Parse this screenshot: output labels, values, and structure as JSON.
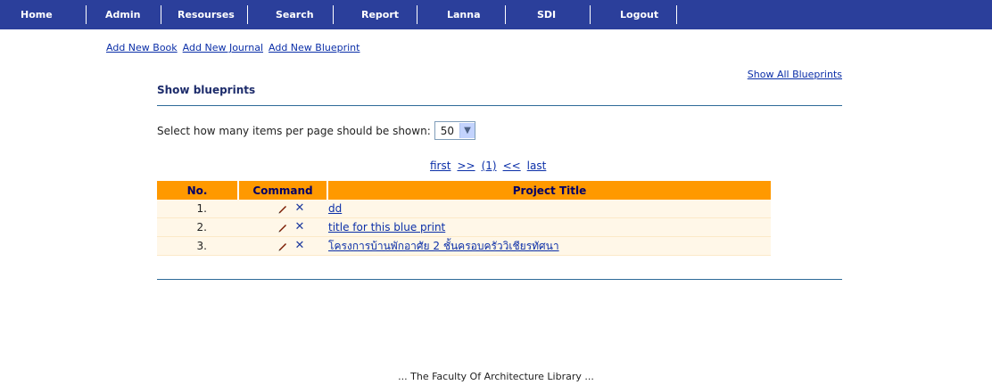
{
  "nav": {
    "items": [
      "Home",
      "Admin",
      "Resourses",
      "Search",
      "Report",
      "Lanna",
      "SDI",
      "Logout"
    ]
  },
  "actions": {
    "add_book": "Add New Book",
    "add_journal": "Add New Journal",
    "add_blueprint": "Add New Blueprint",
    "show_all": "Show All Blueprints"
  },
  "section": {
    "title": "Show blueprints"
  },
  "per_page": {
    "label": "Select how many items per page should be shown:",
    "selected": "50"
  },
  "pager": {
    "first": "first",
    "next": ">>",
    "current": "(1)",
    "prev": "<<",
    "last": "last"
  },
  "table": {
    "headers": {
      "no": "No.",
      "command": "Command",
      "title": "Project Title"
    },
    "rows": [
      {
        "no": "1.",
        "title": "dd"
      },
      {
        "no": "2.",
        "title": "title for this blue print"
      },
      {
        "no": "3.",
        "title": "โครงการบ้านพักอาศัย 2 ชั้นครอบครัววิเชียรทัศนา"
      }
    ]
  },
  "footer": {
    "text": "... The Faculty Of Architecture Library ..."
  },
  "colors": {
    "navbar": "#2b3f9b",
    "table_header": "#ff9900",
    "row_bg": "#fff7e8",
    "link": "#0b2fa8"
  }
}
